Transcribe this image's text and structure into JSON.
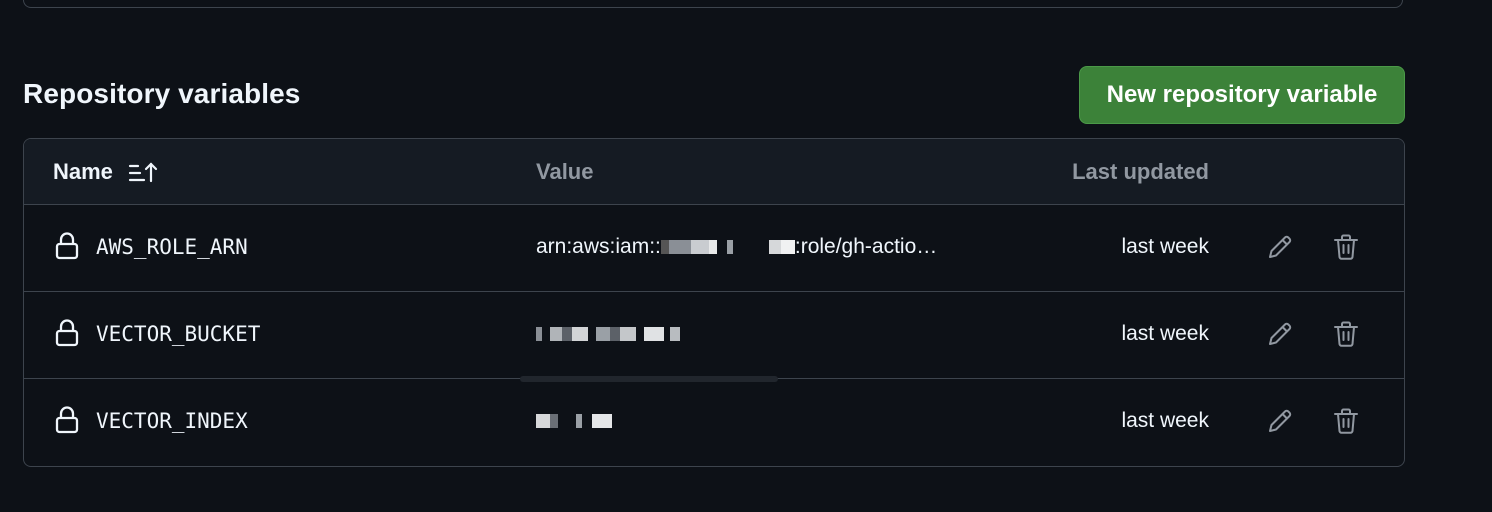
{
  "section": {
    "title": "Repository variables",
    "new_button_label": "New repository variable"
  },
  "table": {
    "headers": {
      "name": "Name",
      "value": "Value",
      "updated": "Last updated"
    },
    "rows": [
      {
        "name": "AWS_ROLE_ARN",
        "value_prefix": "arn:aws:iam::",
        "value_suffix": ":role/gh-actio…",
        "updated": "last week"
      },
      {
        "name": "VECTOR_BUCKET",
        "value_prefix": "",
        "value_suffix": "",
        "updated": "last week"
      },
      {
        "name": "VECTOR_INDEX",
        "value_prefix": "",
        "value_suffix": "",
        "updated": "last week"
      }
    ]
  },
  "icons": {
    "sort": "sort-ascending-icon",
    "lock": "lock-icon",
    "edit": "pencil-icon",
    "delete": "trash-icon"
  },
  "colors": {
    "background": "#0d1117",
    "accent_green": "#3c8239",
    "border": "#3d444d",
    "muted_text": "#9198a1"
  }
}
